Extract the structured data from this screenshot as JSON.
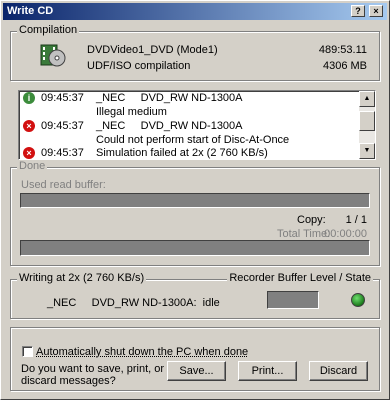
{
  "window": {
    "title": "Write CD",
    "buttons": {
      "help": "?",
      "close": "×"
    }
  },
  "compilation": {
    "legend": "Compilation",
    "name": "DVDVideo1_DVD (Mode1)",
    "type": "UDF/ISO compilation",
    "duration": "489:53.11",
    "size": "4306 MB",
    "icon": "compilation-icon"
  },
  "log": [
    {
      "icon": "info-icon",
      "time": "09:45:37",
      "message": "_NEC     DVD_RW ND-1300A"
    },
    {
      "icon": "",
      "time": "",
      "message": "Illegal medium"
    },
    {
      "icon": "error-icon",
      "time": "09:45:37",
      "message": "_NEC     DVD_RW ND-1300A"
    },
    {
      "icon": "",
      "time": "",
      "message": "Could not perform start of Disc-At-Once"
    },
    {
      "icon": "error-icon",
      "time": "09:45:37",
      "message": "Simulation failed at 2x (2 760 KB/s)"
    }
  ],
  "done": {
    "legend": "Done",
    "used_read_buffer": "Used read buffer:",
    "copy_label": "Copy:",
    "copy_value": "1 / 1",
    "total_time_label": "Total Time:",
    "total_time_value": "00:00:00"
  },
  "writing": {
    "legend": "Writing at 2x (2 760 KB/s)",
    "device_status": "_NEC     DVD_RW ND-1300A:  idle",
    "recorder_label": "Recorder Buffer Level / State",
    "state_color": "#2a9a2a"
  },
  "footer": {
    "shutdown_label": "Automatically shut down the PC when done",
    "shutdown_checked": false,
    "question": "Do you want to save, print, or discard messages?",
    "save_label": "Save...",
    "print_label": "Print...",
    "discard_label": "Discard"
  }
}
